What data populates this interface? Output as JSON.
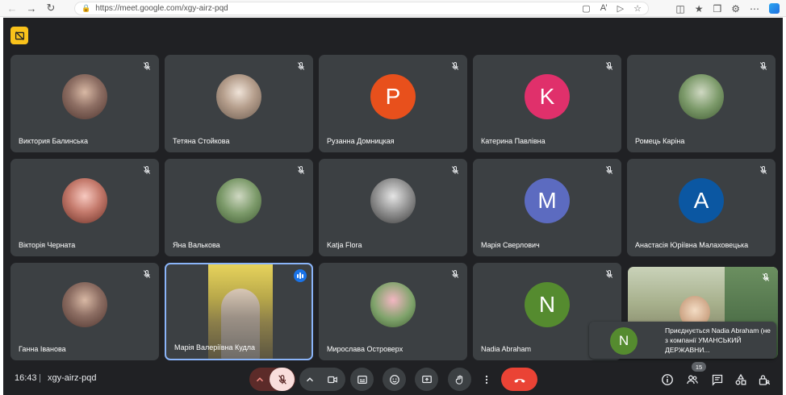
{
  "browser": {
    "url": "https://meet.google.com/xgy-airz-pqd"
  },
  "participants": [
    {
      "name": "Виктория Балинська",
      "avatar_type": "photo"
    },
    {
      "name": "Тетяна Стойкова",
      "avatar_type": "photo"
    },
    {
      "name": "Рузанна Домницкая",
      "avatar_type": "letter",
      "letter": "P",
      "color": "#e8501c"
    },
    {
      "name": "Катерина Павлівна",
      "avatar_type": "letter",
      "letter": "K",
      "color": "#e0306b"
    },
    {
      "name": "Ромець Каріна",
      "avatar_type": "photo"
    },
    {
      "name": "Вікторія Черната",
      "avatar_type": "photo"
    },
    {
      "name": "Яна Валькова",
      "avatar_type": "photo"
    },
    {
      "name": "Katja Flora",
      "avatar_type": "photo"
    },
    {
      "name": "Марія Сверлович",
      "avatar_type": "letter",
      "letter": "M",
      "color": "#5c6bc0"
    },
    {
      "name": "Анастасія Юріївна Малаховецька",
      "avatar_type": "letter",
      "letter": "A",
      "color": "#0b57a2"
    },
    {
      "name": "Ганна Іванова",
      "avatar_type": "photo"
    },
    {
      "name": "Марія Валеріївна Кудла",
      "avatar_type": "video",
      "speaking": true
    },
    {
      "name": "Мирослава Островерх",
      "avatar_type": "photo"
    },
    {
      "name": "Nadia Abraham",
      "avatar_type": "letter",
      "letter": "N",
      "color": "#558b2f"
    }
  ],
  "toast": {
    "letter": "N",
    "text": "Приєднується Nadia Abraham (не з компанії УМАНСЬКИЙ ДЕРЖАВНИ..."
  },
  "bottom_bar": {
    "time": "16:43",
    "separator": "|",
    "meeting_code": "xgy-airz-pqd",
    "participants_count": "15"
  },
  "colors": {
    "background": "#202124",
    "tile": "#3c4043",
    "end_call": "#ea4335",
    "mic_off_bg": "#f9dedc",
    "speaking": "#1a73e8"
  },
  "icons": {
    "info": "info-icon",
    "people": "people-icon",
    "chat": "chat-icon",
    "activities": "activities-icon",
    "host_controls": "lock-person-icon"
  }
}
